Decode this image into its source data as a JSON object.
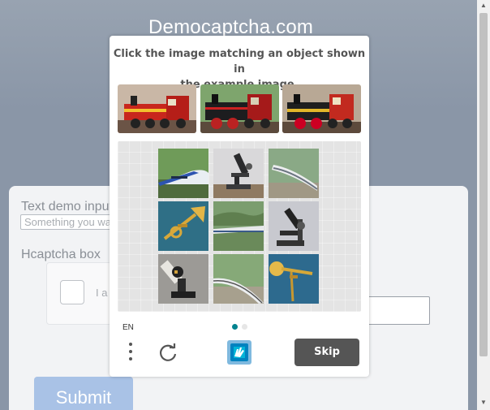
{
  "page": {
    "site_title": "Democaptcha.com",
    "text_demo_label": "Text demo input",
    "text_demo_placeholder": "Something you wa",
    "hcaptcha_box_label": "Hcaptcha box",
    "hcaptcha_checkbox_label": "I a",
    "submit_label": "Submit"
  },
  "challenge": {
    "prompt_line1": "Click the image matching an object shown in",
    "prompt_line2": "the example image.",
    "example_images": [
      "red-toy-steam-locomotive",
      "black-red-steam-locomotive",
      "red-black-steam-locomotive"
    ],
    "tiles": [
      "high-speed-train",
      "microscope",
      "high-speed-train",
      "trumpet",
      "high-speed-train",
      "microscope",
      "microscope",
      "high-speed-train",
      "trumpet"
    ],
    "language": "EN",
    "page_indicator": {
      "pages": 2,
      "current": 1
    },
    "skip_label": "Skip",
    "colors": {
      "accent": "#00838f",
      "skip_bg": "#555555"
    }
  }
}
